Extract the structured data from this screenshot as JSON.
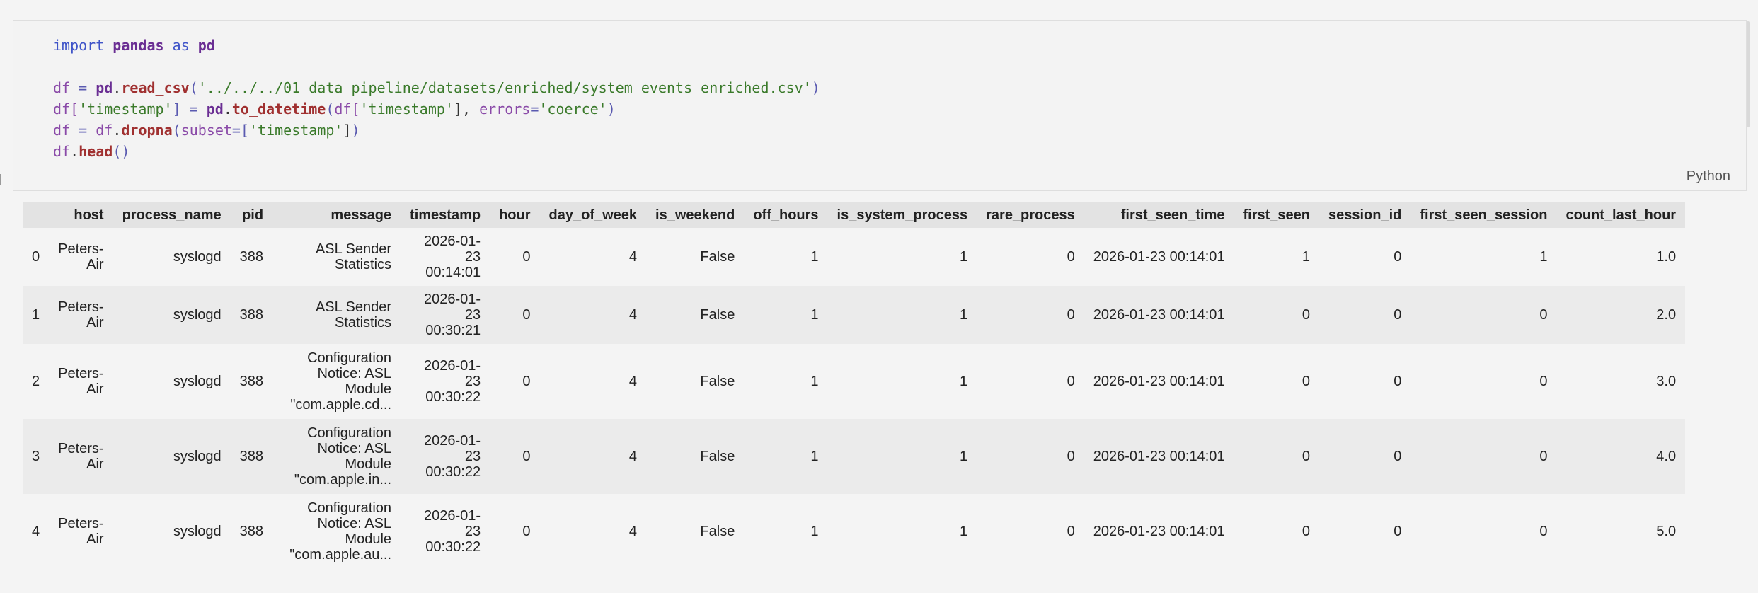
{
  "code_cell": {
    "language_label": "Python",
    "lines": {
      "l1": {
        "t1": "import",
        "t2": " ",
        "t3": "pandas",
        "t4": " ",
        "t5": "as",
        "t6": " ",
        "t7": "pd"
      },
      "l3": {
        "t1": "df",
        "t2": " = ",
        "t3": "pd",
        "t4": ".",
        "t5": "read_csv",
        "t6": "(",
        "t7": "'../../../01_data_pipeline/datasets/enriched/system_events_enriched.csv'",
        "t8": ")"
      },
      "l4": {
        "t1": "df[",
        "t2": "'timestamp'",
        "t3": "] = ",
        "t4": "pd",
        "t5": ".",
        "t6": "to_datetime",
        "t7": "(",
        "t8": "df[",
        "t9": "'timestamp'",
        "t10": "], ",
        "t11": "errors",
        "t12": "=",
        "t13": "'coerce'",
        "t14": ")"
      },
      "l5": {
        "t1": "df",
        "t2": " = ",
        "t3": "df",
        "t4": ".",
        "t5": "dropna",
        "t6": "(",
        "t7": "subset",
        "t8": "=[",
        "t9": "'timestamp'",
        "t10": "]",
        "t11": ")"
      },
      "l6": {
        "t1": "df",
        "t2": ".",
        "t3": "head",
        "t4": "()"
      }
    }
  },
  "table": {
    "columns": {
      "host": "host",
      "process_name": "process_name",
      "pid": "pid",
      "message": "message",
      "timestamp": "timestamp",
      "hour": "hour",
      "day_of_week": "day_of_week",
      "is_weekend": "is_weekend",
      "off_hours": "off_hours",
      "is_system_process": "is_system_process",
      "rare_process": "rare_process",
      "first_seen_time": "first_seen_time",
      "first_seen": "first_seen",
      "session_id": "session_id",
      "first_seen_session": "first_seen_session",
      "count_last_hour": "count_last_hour"
    },
    "rows": [
      {
        "index": "0",
        "host": "Peters-Air",
        "process_name": "syslogd",
        "pid": "388",
        "message": "ASL Sender Statistics",
        "timestamp": "2026-01-23 00:14:01",
        "hour": "0",
        "day_of_week": "4",
        "is_weekend": "False",
        "off_hours": "1",
        "is_system_process": "1",
        "rare_process": "0",
        "first_seen_time": "2026-01-23 00:14:01",
        "first_seen": "1",
        "session_id": "0",
        "first_seen_session": "1",
        "count_last_hour": "1.0"
      },
      {
        "index": "1",
        "host": "Peters-Air",
        "process_name": "syslogd",
        "pid": "388",
        "message": "ASL Sender Statistics",
        "timestamp": "2026-01-23 00:30:21",
        "hour": "0",
        "day_of_week": "4",
        "is_weekend": "False",
        "off_hours": "1",
        "is_system_process": "1",
        "rare_process": "0",
        "first_seen_time": "2026-01-23 00:14:01",
        "first_seen": "0",
        "session_id": "0",
        "first_seen_session": "0",
        "count_last_hour": "2.0"
      },
      {
        "index": "2",
        "host": "Peters-Air",
        "process_name": "syslogd",
        "pid": "388",
        "message": "Configuration Notice: ASL Module \"com.apple.cd...",
        "timestamp": "2026-01-23 00:30:22",
        "hour": "0",
        "day_of_week": "4",
        "is_weekend": "False",
        "off_hours": "1",
        "is_system_process": "1",
        "rare_process": "0",
        "first_seen_time": "2026-01-23 00:14:01",
        "first_seen": "0",
        "session_id": "0",
        "first_seen_session": "0",
        "count_last_hour": "3.0"
      },
      {
        "index": "3",
        "host": "Peters-Air",
        "process_name": "syslogd",
        "pid": "388",
        "message": "Configuration Notice: ASL Module \"com.apple.in...",
        "timestamp": "2026-01-23 00:30:22",
        "hour": "0",
        "day_of_week": "4",
        "is_weekend": "False",
        "off_hours": "1",
        "is_system_process": "1",
        "rare_process": "0",
        "first_seen_time": "2026-01-23 00:14:01",
        "first_seen": "0",
        "session_id": "0",
        "first_seen_session": "0",
        "count_last_hour": "4.0"
      },
      {
        "index": "4",
        "host": "Peters-Air",
        "process_name": "syslogd",
        "pid": "388",
        "message": "Configuration Notice: ASL Module \"com.apple.au...",
        "timestamp": "2026-01-23 00:30:22",
        "hour": "0",
        "day_of_week": "4",
        "is_weekend": "False",
        "off_hours": "1",
        "is_system_process": "1",
        "rare_process": "0",
        "first_seen_time": "2026-01-23 00:14:01",
        "first_seen": "0",
        "session_id": "0",
        "first_seen_session": "0",
        "count_last_hour": "5.0"
      }
    ]
  }
}
